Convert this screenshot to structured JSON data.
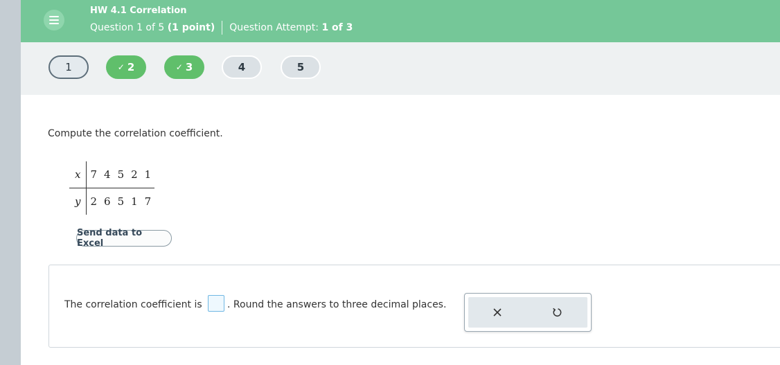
{
  "header": {
    "assignment_title": "HW 4.1 Correlation",
    "question_prefix": "Question 1 of 5",
    "question_points": "(1 point)",
    "attempt_prefix": "Question Attempt:",
    "attempt_value": "1 of 3",
    "menu_icon": "hamburger-menu-icon"
  },
  "navigation": {
    "questions": [
      {
        "label": "1",
        "state": "current"
      },
      {
        "label": "2",
        "state": "completed"
      },
      {
        "label": "3",
        "state": "completed"
      },
      {
        "label": "4",
        "state": "not-answered"
      },
      {
        "label": "5",
        "state": "not-answered"
      }
    ],
    "check_icon": "✓"
  },
  "question": {
    "prompt": "Compute the correlation coefficient.",
    "table": {
      "x_label": "x",
      "y_label": "y",
      "x_values": [
        "7",
        "4",
        "5",
        "2",
        "1"
      ],
      "y_values": [
        "2",
        "6",
        "5",
        "1",
        "7"
      ]
    },
    "excel_button_label": "Send data to Excel"
  },
  "answer": {
    "text_before": "The correlation coefficient is",
    "input_value": "",
    "text_after": ". Round the answers to three decimal places.",
    "tools": [
      "clear-icon",
      "undo-icon"
    ]
  },
  "colors": {
    "header_bg": "#75c798",
    "completed_green": "#60bf6b",
    "nav_bg": "#eef1f2",
    "input_border": "#6fb7e3"
  }
}
